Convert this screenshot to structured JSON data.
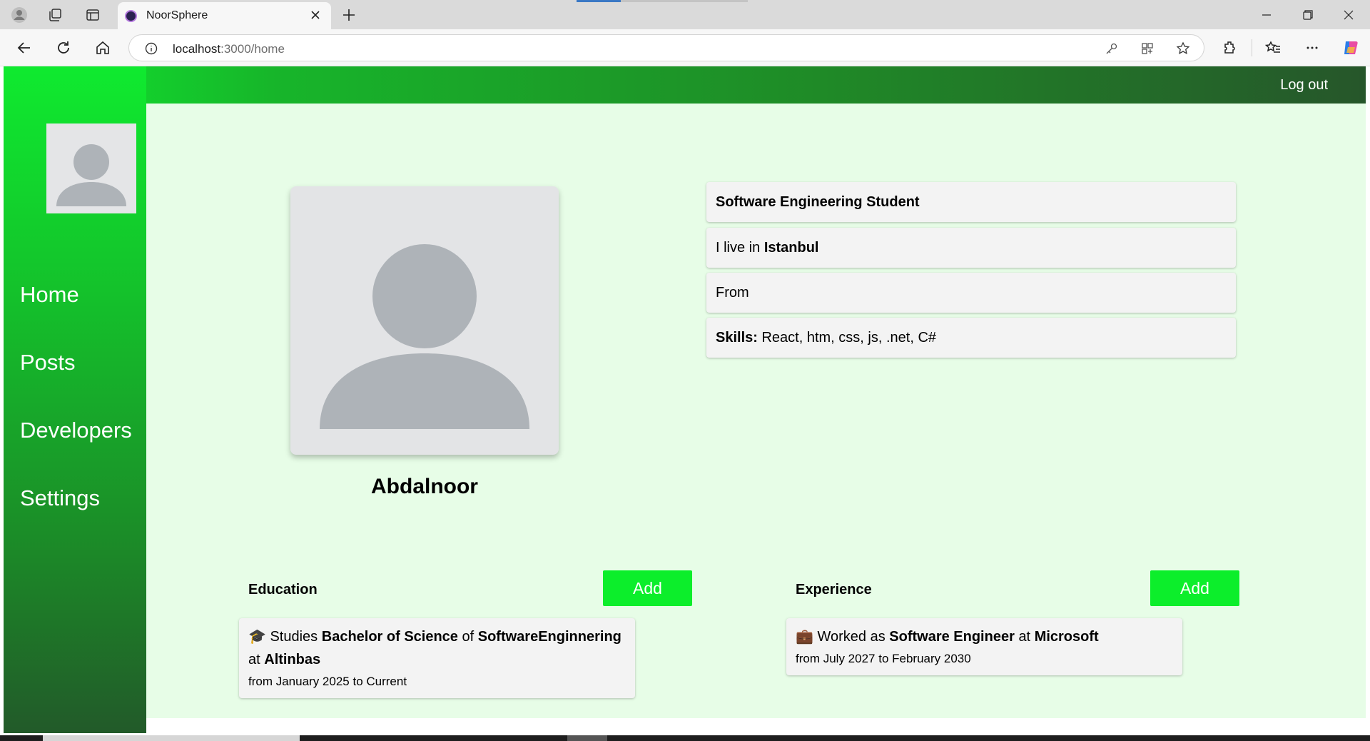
{
  "browser": {
    "tab_title": "NoorSphere",
    "url_host": "localhost",
    "url_path": ":3000/home"
  },
  "header": {
    "logout_label": "Log out"
  },
  "sidebar": {
    "items": [
      {
        "label": "Home"
      },
      {
        "label": "Posts"
      },
      {
        "label": "Developers"
      },
      {
        "label": "Settings"
      }
    ]
  },
  "profile": {
    "name": "Abdalnoor",
    "title": "Software Engineering Student",
    "lives_prefix": "I live in",
    "city": "Istanbul",
    "from_label": "From",
    "skills_label": "Skills:",
    "skills": "React, htm, css, js, .net, C#"
  },
  "education": {
    "title": "Education",
    "add_label": "Add",
    "entries": [
      {
        "icon": "🎓",
        "studies_word": "Studies",
        "degree": "Bachelor of Science",
        "of_word": "of",
        "field": "SoftwareEnginnering",
        "at_word": "at",
        "school": "Altinbas",
        "dates": "from January 2025 to Current"
      }
    ]
  },
  "experience": {
    "title": "Experience",
    "add_label": "Add",
    "entries": [
      {
        "icon": "💼",
        "worked_as": "Worked as",
        "position": "Software Engineer",
        "at_word": "at",
        "company": "Microsoft",
        "dates": "from July 2027 to February 2030"
      }
    ]
  },
  "colors": {
    "accent_green": "#0cee2b",
    "main_background": "#e7fde7",
    "sidebar_dark": "#225a29"
  }
}
